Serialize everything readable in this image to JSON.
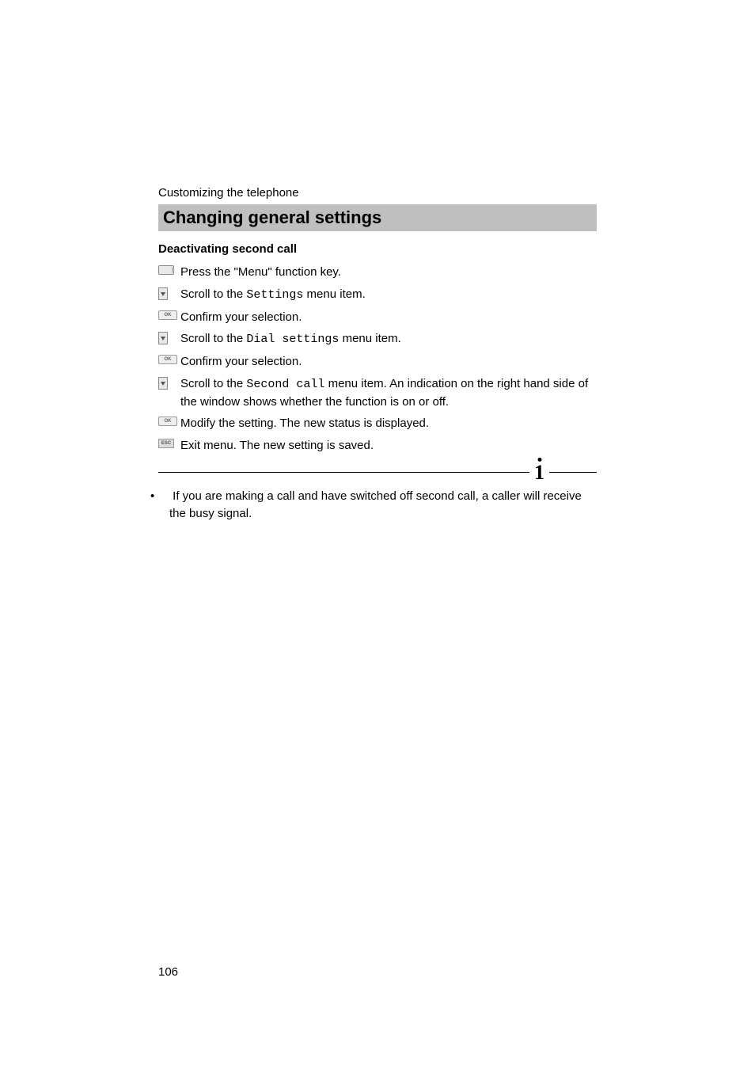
{
  "breadcrumb": "Customizing the telephone",
  "section_title": "Changing general settings",
  "subhead": "Deactivating second call",
  "steps": [
    {
      "icon": "function-key-icon",
      "prefix": "",
      "mono": "",
      "mid": "",
      "mono2": "",
      "suffix": "Press the \"Menu\" function key."
    },
    {
      "icon": "scroll-down-icon",
      "prefix": "Scroll to the ",
      "mono": "Settings",
      "mid": " menu item.",
      "mono2": "",
      "suffix": ""
    },
    {
      "icon": "ok-key-icon",
      "prefix": "",
      "mono": "",
      "mid": "",
      "mono2": "",
      "suffix": "Confirm your selection."
    },
    {
      "icon": "scroll-down-icon",
      "prefix": "Scroll to the ",
      "mono": "Dial settings",
      "mid": " menu item.",
      "mono2": "",
      "suffix": ""
    },
    {
      "icon": "ok-key-icon",
      "prefix": "",
      "mono": "",
      "mid": "",
      "mono2": "",
      "suffix": "Confirm your selection."
    },
    {
      "icon": "scroll-down-icon",
      "prefix": "Scroll to the ",
      "mono": "Second call",
      "mid": " menu item. An indication on the right hand side of the window shows whether the function is on or off.",
      "mono2": "",
      "suffix": ""
    },
    {
      "icon": "ok-key-icon",
      "prefix": "",
      "mono": "",
      "mid": "",
      "mono2": "",
      "suffix": "Modify the setting. The new status is displayed."
    },
    {
      "icon": "esc-key-icon",
      "prefix": "",
      "mono": "",
      "mid": "",
      "mono2": "",
      "suffix": "Exit menu. The new setting is saved."
    }
  ],
  "ok_label": "OK",
  "esc_label": "ESC",
  "info_glyph": "1",
  "note_bullet": "•",
  "note_text": "If you are making a call and have switched off second call, a caller will receive the busy signal.",
  "page_number": "106"
}
